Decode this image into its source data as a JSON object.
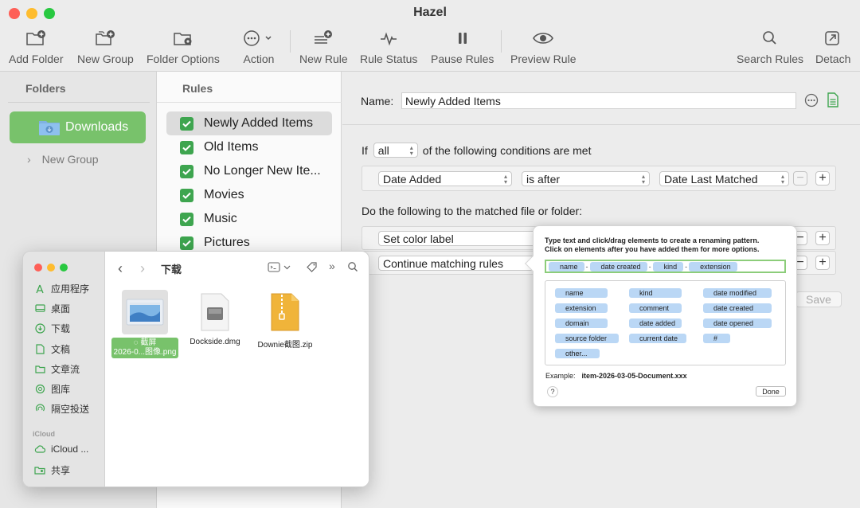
{
  "window": {
    "title": "Hazel",
    "traffic_colors": [
      "#fe5f57",
      "#febc2e",
      "#28c840"
    ]
  },
  "toolbar": {
    "add_folder": "Add Folder",
    "new_group": "New Group",
    "folder_options": "Folder Options",
    "action": "Action",
    "new_rule": "New Rule",
    "rule_status": "Rule Status",
    "pause_rules": "Pause Rules",
    "preview_rule": "Preview Rule",
    "search_rules": "Search Rules",
    "detach": "Detach"
  },
  "folders": {
    "header": "Folders",
    "selected": "Downloads",
    "group": "New Group"
  },
  "rules": {
    "header": "Rules",
    "items": [
      {
        "label": "Newly Added Items",
        "checked": true
      },
      {
        "label": "Old Items",
        "checked": true
      },
      {
        "label": "No Longer New Ite...",
        "checked": true
      },
      {
        "label": "Movies",
        "checked": true
      },
      {
        "label": "Music",
        "checked": true
      },
      {
        "label": "Pictures",
        "checked": true
      }
    ]
  },
  "editor": {
    "name_label": "Name:",
    "name_value": "Newly Added Items",
    "if_label": "If",
    "match_mode": "all",
    "conditions_text": "of the following conditions are met",
    "condition": {
      "attribute": "Date Added",
      "operator": "is after",
      "value": "Date Last Matched"
    },
    "do_text": "Do the following to the matched file or folder:",
    "actions": [
      {
        "label": "Set color label"
      },
      {
        "label": "Continue matching rules"
      }
    ],
    "save_label": "Save"
  },
  "rename_popover": {
    "instructions_line1": "Type text and click/drag elements to create a renaming pattern.",
    "instructions_line2": "Click on elements after you have added them for more options.",
    "pattern_tokens": [
      "name",
      "date created",
      "kind",
      "extension"
    ],
    "pattern_separator": "-",
    "available_tokens": [
      "name",
      "kind",
      "date modified",
      "extension",
      "comment",
      "date created",
      "domain",
      "date added",
      "date opened",
      "source folder",
      "current date",
      "#",
      "other..."
    ],
    "example_label": "Example:",
    "example_value": "item-2026-03-05-Document.xxx",
    "help_label": "?",
    "done_label": "Done"
  },
  "finder": {
    "traffic_colors": [
      "#fe5f57",
      "#febc2e",
      "#28c840"
    ],
    "title": "下载",
    "sidebar": [
      {
        "label": "应用程序",
        "icon": "apps-icon"
      },
      {
        "label": "桌面",
        "icon": "desktop-icon"
      },
      {
        "label": "下载",
        "icon": "download-icon"
      },
      {
        "label": "文稿",
        "icon": "document-icon"
      },
      {
        "label": "文章流",
        "icon": "folder-icon"
      },
      {
        "label": "图库",
        "icon": "photos-icon"
      },
      {
        "label": "隔空投送",
        "icon": "airdrop-icon"
      }
    ],
    "icloud_section": "iCloud",
    "icloud_items": [
      {
        "label": "iCloud ...",
        "icon": "cloud-icon"
      },
      {
        "label": "共享",
        "icon": "shared-folder-icon"
      }
    ],
    "files": [
      {
        "name_line1": "截屏",
        "name_line2": "2026-0...图像.png",
        "selected": true
      },
      {
        "name_line1": "Dockside.dmg",
        "selected": false
      },
      {
        "name_line1": "Downie截图.zip",
        "selected": false
      }
    ]
  },
  "colors": {
    "accent_green": "#78c26b",
    "checkbox_green": "#3ea54f",
    "token_blue": "#bad7f5"
  }
}
